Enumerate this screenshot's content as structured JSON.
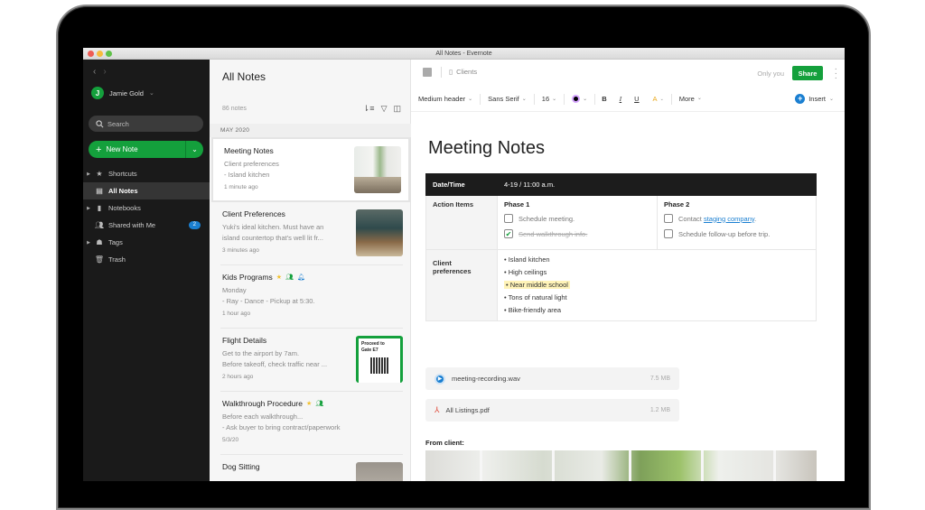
{
  "window": {
    "title": "All Notes - Evernote"
  },
  "sidebar": {
    "nav_back": "‹",
    "nav_forward": "›",
    "user": {
      "initial": "J",
      "name": "Jamie Gold",
      "caret": "⌄"
    },
    "search_placeholder": "Search",
    "new_note_label": "New Note",
    "items": [
      {
        "label": "Shortcuts",
        "icon": "star-icon",
        "expandable": true
      },
      {
        "label": "All Notes",
        "icon": "note-icon",
        "active": true
      },
      {
        "label": "Notebooks",
        "icon": "notebook-icon",
        "expandable": true
      },
      {
        "label": "Shared with Me",
        "icon": "people-icon",
        "badge": "2"
      },
      {
        "label": "Tags",
        "icon": "tag-icon",
        "expandable": true
      },
      {
        "label": "Trash",
        "icon": "trash-icon"
      }
    ]
  },
  "note_list": {
    "title": "All Notes",
    "count": "86 notes",
    "month": "MAY 2020",
    "notes": [
      {
        "title": "Meeting Notes",
        "lines": [
          "Client preferences",
          "- Island kitchen"
        ],
        "time": "1 minute ago",
        "selected": true
      },
      {
        "title": "Client Preferences",
        "lines": [
          "Yuki's ideal kitchen. Must have an",
          "island countertop that's well lit fr..."
        ],
        "time": "3 minutes ago"
      },
      {
        "title": "Kids Programs",
        "lines": [
          "Monday",
          "- Ray - Dance - Pickup at 5:30."
        ],
        "time": "1 hour ago"
      },
      {
        "title": "Flight Details",
        "lines": [
          "Get to the airport by 7am.",
          "Before takeoff, check traffic near ..."
        ],
        "time": "2 hours ago",
        "ticket": {
          "line1": "Proceed to",
          "line2": "Gate E7"
        }
      },
      {
        "title": "Walkthrough Procedure",
        "lines": [
          "Before each walkthrough...",
          "- Ask buyer to bring contract/paperwork"
        ],
        "time": "5/3/20"
      },
      {
        "title": "Dog Sitting",
        "lines": [],
        "time": ""
      }
    ]
  },
  "editor": {
    "notebook": "Clients",
    "sharing_status": "Only you",
    "share_label": "Share",
    "toolbar": {
      "style": "Medium header",
      "font": "Sans Serif",
      "size": "16",
      "bold": "B",
      "italic": "I",
      "underline": "U",
      "highlight": "A",
      "more": "More",
      "insert": "Insert"
    },
    "title": "Meeting Notes",
    "table": {
      "datetime_label": "Date/Time",
      "datetime_value": "4-19 / 11:00 a.m.",
      "action_label": "Action Items",
      "phase1": {
        "title": "Phase 1",
        "items": [
          {
            "text": "Schedule meeting.",
            "done": false
          },
          {
            "text": "Send walkthrough info.",
            "done": true
          }
        ]
      },
      "phase2": {
        "title": "Phase 2",
        "item1_prefix": "Contact ",
        "item1_link": "staging company",
        "item1_suffix": ".",
        "item2": "Schedule follow-up before trip."
      },
      "prefs_label": "Client preferences",
      "prefs": [
        "Island kitchen",
        "High ceilings",
        "Near middle school",
        "Tons of natural light",
        "Bike-friendly area"
      ]
    },
    "attachments": [
      {
        "name": "meeting-recording.wav",
        "size": "7.5 MB",
        "icon": "audio-play-icon"
      },
      {
        "name": "All Listings.pdf",
        "size": "1.2 MB",
        "icon": "pdf-icon"
      }
    ],
    "from_client": "From client:"
  },
  "colors": {
    "accent_green": "#14a03c",
    "badge_blue": "#1a7fd1",
    "sidebar_bg": "#1a1a1a",
    "highlight": "#fff3b8"
  }
}
